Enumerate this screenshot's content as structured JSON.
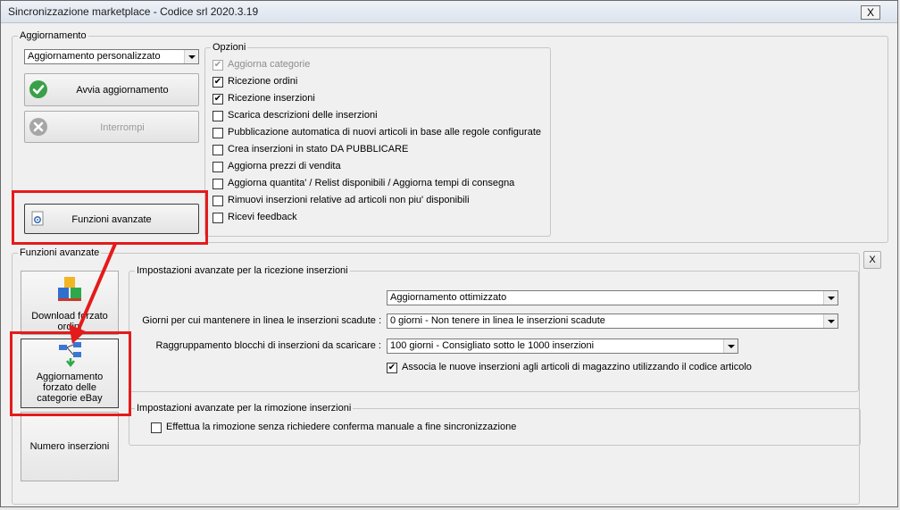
{
  "window": {
    "title": "Sincronizzazione marketplace - Codice srl 2020.3.19",
    "close_label": "X"
  },
  "aggiornamento": {
    "group_label": "Aggiornamento",
    "mode_select": {
      "value": "Aggiornamento personalizzato"
    },
    "start_button": {
      "label": "Avvia aggiornamento",
      "icon": "check-circle-icon"
    },
    "stop_button": {
      "label": "Interrompi",
      "icon": "x-circle-icon",
      "disabled": true
    },
    "advanced_button": {
      "label": "Funzioni avanzate",
      "icon": "gear-icon"
    }
  },
  "opzioni": {
    "group_label": "Opzioni",
    "items": [
      {
        "label": "Aggiorna categorie",
        "checked": true,
        "disabled": true
      },
      {
        "label": "Ricezione ordini",
        "checked": true,
        "disabled": false
      },
      {
        "label": "Ricezione inserzioni",
        "checked": true,
        "disabled": false
      },
      {
        "label": "Scarica descrizioni delle inserzioni",
        "checked": false,
        "disabled": false
      },
      {
        "label": "Pubblicazione automatica di nuovi articoli in base alle regole configurate",
        "checked": false,
        "disabled": false
      },
      {
        "label": "Crea inserzioni in stato DA PUBBLICARE",
        "checked": false,
        "disabled": false
      },
      {
        "label": "Aggiorna prezzi di vendita",
        "checked": false,
        "disabled": false
      },
      {
        "label": "Aggiorna quantita' / Relist disponibili / Aggiorna tempi di consegna",
        "checked": false,
        "disabled": false
      },
      {
        "label": "Rimuovi inserzioni relative ad articoli non piu' disponibili",
        "checked": false,
        "disabled": false
      },
      {
        "label": "Ricevi feedback",
        "checked": false,
        "disabled": false
      }
    ]
  },
  "funzioni_avanzate": {
    "group_label": "Funzioni avanzate",
    "close_label": "X",
    "side_buttons": {
      "download": {
        "label_line1": "Download forzato",
        "label_line2": "ordini"
      },
      "categorie": {
        "label_line1": "Aggiornamento",
        "label_line2": "forzato delle",
        "label_line3": "categorie eBay"
      },
      "numero": {
        "label": "Numero inserzioni"
      }
    },
    "ricezione": {
      "group_label": "Impostazioni avanzate per la ricezione inserzioni",
      "mode_select": {
        "value": "Aggiornamento ottimizzato"
      },
      "giorni_label": "Giorni per cui mantenere in linea le inserzioni scadute :",
      "giorni_select": {
        "value": "0 giorni - Non tenere in linea le inserzioni scadute"
      },
      "raggruppamento_label": "Raggruppamento blocchi di inserzioni da scaricare :",
      "raggruppamento_select": {
        "value": "100 giorni - Consigliato sotto le 1000 inserzioni"
      },
      "associa_check": {
        "label": "Associa le nuove inserzioni agli articoli di magazzino utilizzando il codice articolo",
        "checked": true
      }
    },
    "rimozione": {
      "group_label": "Impostazioni avanzate per la rimozione inserzioni",
      "conferma_check": {
        "label": "Effettua la rimozione senza richiedere conferma manuale a fine sincronizzazione",
        "checked": false
      }
    }
  },
  "annotation": {
    "highlight_color": "#e41b1b"
  }
}
